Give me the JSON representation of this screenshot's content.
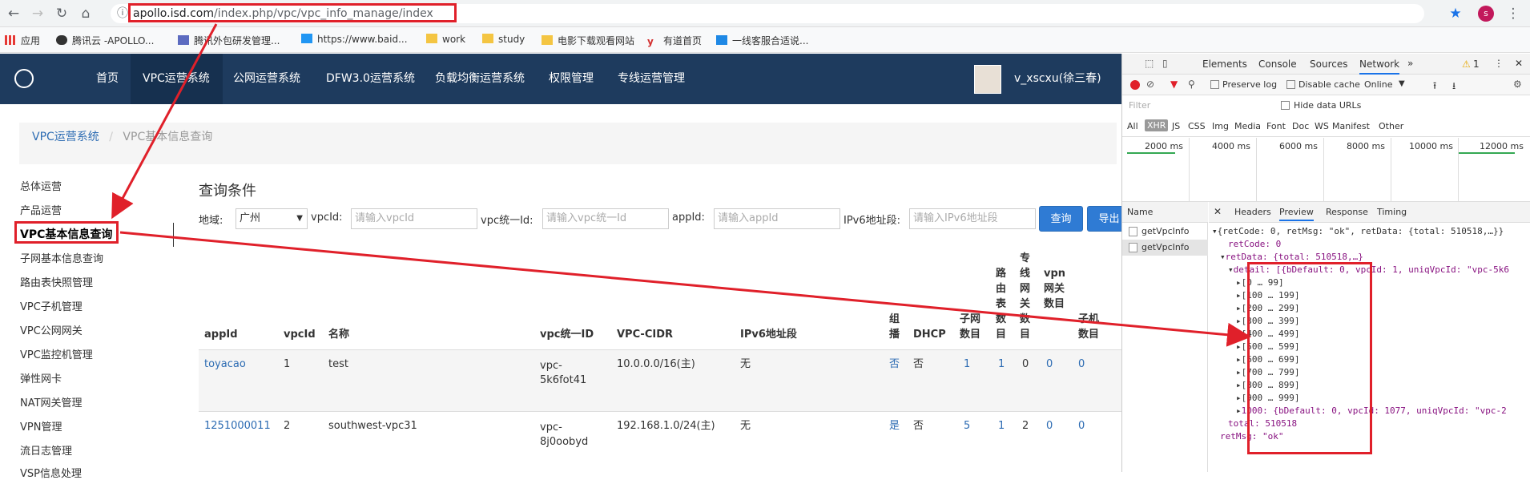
{
  "browser": {
    "url_host": "apollo.isd.com",
    "url_path": "/index.php/vpc/vpc_info_manage/index",
    "bookmarks": [
      "应用",
      "腾讯云 -APOLLO...",
      "腾讯外包研发管理...",
      "https://www.baid...",
      "work",
      "study",
      "电影下载观看网站",
      "有道首页",
      "一线客服合适说..."
    ],
    "avatar_letter": "s"
  },
  "nav": {
    "items": [
      "首页",
      "VPC运营系统",
      "公网运营系统",
      "DFW3.0运营系统",
      "负载均衡运营系统",
      "权限管理",
      "专线运营管理"
    ],
    "user": "v_xscxu(徐三春)"
  },
  "breadcrumb": {
    "root": "VPC运营系统",
    "current": "VPC基本信息查询"
  },
  "sidebar": {
    "items": [
      "总体运营",
      "产品运营",
      "VPC基本信息查询",
      "子网基本信息查询",
      "路由表快照管理",
      "VPC子机管理",
      "VPC公网网关",
      "VPC监控机管理",
      "弹性网卡",
      "NAT网关管理",
      "VPN管理",
      "流日志管理",
      "VSP信息处理"
    ]
  },
  "query": {
    "title": "查询条件",
    "region_label": "地域:",
    "region_value": "广州",
    "vpcid_label": "vpcId:",
    "vpcid_placeholder": "请输入vpcId",
    "uniq_label": "vpc统一Id:",
    "uniq_placeholder": "请输入vpc统一Id",
    "appid_label": "appId:",
    "appid_placeholder": "请输入appId",
    "ipv6_label": "IPv6地址段:",
    "ipv6_placeholder": "请输入IPv6地址段",
    "search_button": "查询",
    "export_button": "导出"
  },
  "table": {
    "headers": [
      "appId",
      "vpcId",
      "名称",
      "vpc统一ID",
      "VPC-CIDR",
      "IPv6地址段",
      "组播",
      "DHCP",
      "子网数目",
      "路由表数目",
      "专线网关数目",
      "vpn网关数目",
      "子机数目"
    ],
    "rows": [
      {
        "appid": "toyacao",
        "vpcid": "1",
        "name": "test",
        "uniq_a": "vpc-",
        "uniq_b": "5k6fot41",
        "cidr": "10.0.0.0/16(主)",
        "ipv6": "无",
        "multicast": "否",
        "dhcp": "否",
        "subnets": "1",
        "routes": "1",
        "dc": "0",
        "vpn": "0",
        "vm": "0"
      },
      {
        "appid": "1251000011",
        "vpcid": "2",
        "name": "southwest-vpc31",
        "uniq_a": "vpc-",
        "uniq_b": "8j0oobyd",
        "cidr": "192.168.1.0/24(主)",
        "ipv6": "无",
        "multicast": "是",
        "dhcp": "否",
        "subnets": "5",
        "routes": "1",
        "dc": "2",
        "vpn": "0",
        "vm": "0"
      }
    ]
  },
  "devtools": {
    "tabs": [
      "Elements",
      "Console",
      "Sources",
      "Network"
    ],
    "warnings": "1",
    "preserve_log": "Preserve log",
    "disable_cache": "Disable cache",
    "online": "Online",
    "filter_placeholder": "Filter",
    "hide_data_urls": "Hide data URLs",
    "types": [
      "All",
      "XHR",
      "JS",
      "CSS",
      "Img",
      "Media",
      "Font",
      "Doc",
      "WS",
      "Manifest",
      "Other"
    ],
    "timeline": [
      "2000 ms",
      "4000 ms",
      "6000 ms",
      "8000 ms",
      "10000 ms",
      "12000 ms"
    ],
    "name_header": "Name",
    "requests": [
      "getVpcInfo",
      "getVpcInfo"
    ],
    "detail_tabs": [
      "Headers",
      "Preview",
      "Response",
      "Timing"
    ],
    "preview": {
      "root": "{retCode: 0, retMsg: \"ok\", retData: {total: 510518,…}}",
      "retcode": "retCode: 0",
      "retdata": "retData: {total: 510518,…}",
      "detail": "detail: [{bDefault: 0, vpcId: 1, uniqVpcId: \"vpc-5k6",
      "ranges": [
        "[0 … 99]",
        "[100 … 199]",
        "[200 … 299]",
        "[300 … 399]",
        "[400 … 499]",
        "[500 … 599]",
        "[600 … 699]",
        "[700 … 799]",
        "[800 … 899]",
        "[900 … 999]"
      ],
      "last": "1000: {bDefault: 0, vpcId: 1077, uniqVpcId: \"vpc-2",
      "total": "total: 510518",
      "retmsg": "retMsg: \"ok\""
    }
  }
}
